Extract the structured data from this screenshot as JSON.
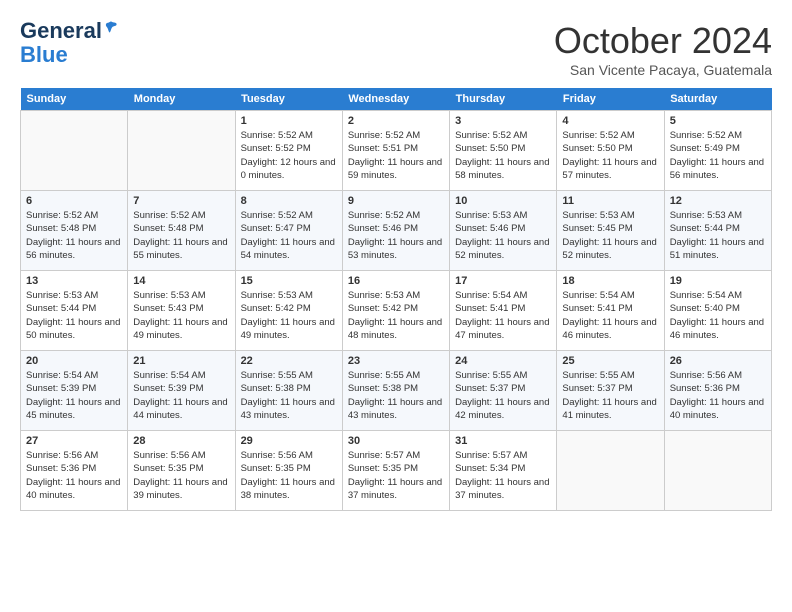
{
  "header": {
    "logo": {
      "line1": "General",
      "line2": "Blue"
    },
    "title": "October 2024",
    "subtitle": "San Vicente Pacaya, Guatemala"
  },
  "weekdays": [
    "Sunday",
    "Monday",
    "Tuesday",
    "Wednesday",
    "Thursday",
    "Friday",
    "Saturday"
  ],
  "weeks": [
    [
      {
        "day": null
      },
      {
        "day": null
      },
      {
        "day": "1",
        "sunrise": "Sunrise: 5:52 AM",
        "sunset": "Sunset: 5:52 PM",
        "daylight": "Daylight: 12 hours and 0 minutes."
      },
      {
        "day": "2",
        "sunrise": "Sunrise: 5:52 AM",
        "sunset": "Sunset: 5:51 PM",
        "daylight": "Daylight: 11 hours and 59 minutes."
      },
      {
        "day": "3",
        "sunrise": "Sunrise: 5:52 AM",
        "sunset": "Sunset: 5:50 PM",
        "daylight": "Daylight: 11 hours and 58 minutes."
      },
      {
        "day": "4",
        "sunrise": "Sunrise: 5:52 AM",
        "sunset": "Sunset: 5:50 PM",
        "daylight": "Daylight: 11 hours and 57 minutes."
      },
      {
        "day": "5",
        "sunrise": "Sunrise: 5:52 AM",
        "sunset": "Sunset: 5:49 PM",
        "daylight": "Daylight: 11 hours and 56 minutes."
      }
    ],
    [
      {
        "day": "6",
        "sunrise": "Sunrise: 5:52 AM",
        "sunset": "Sunset: 5:48 PM",
        "daylight": "Daylight: 11 hours and 56 minutes."
      },
      {
        "day": "7",
        "sunrise": "Sunrise: 5:52 AM",
        "sunset": "Sunset: 5:48 PM",
        "daylight": "Daylight: 11 hours and 55 minutes."
      },
      {
        "day": "8",
        "sunrise": "Sunrise: 5:52 AM",
        "sunset": "Sunset: 5:47 PM",
        "daylight": "Daylight: 11 hours and 54 minutes."
      },
      {
        "day": "9",
        "sunrise": "Sunrise: 5:52 AM",
        "sunset": "Sunset: 5:46 PM",
        "daylight": "Daylight: 11 hours and 53 minutes."
      },
      {
        "day": "10",
        "sunrise": "Sunrise: 5:53 AM",
        "sunset": "Sunset: 5:46 PM",
        "daylight": "Daylight: 11 hours and 52 minutes."
      },
      {
        "day": "11",
        "sunrise": "Sunrise: 5:53 AM",
        "sunset": "Sunset: 5:45 PM",
        "daylight": "Daylight: 11 hours and 52 minutes."
      },
      {
        "day": "12",
        "sunrise": "Sunrise: 5:53 AM",
        "sunset": "Sunset: 5:44 PM",
        "daylight": "Daylight: 11 hours and 51 minutes."
      }
    ],
    [
      {
        "day": "13",
        "sunrise": "Sunrise: 5:53 AM",
        "sunset": "Sunset: 5:44 PM",
        "daylight": "Daylight: 11 hours and 50 minutes."
      },
      {
        "day": "14",
        "sunrise": "Sunrise: 5:53 AM",
        "sunset": "Sunset: 5:43 PM",
        "daylight": "Daylight: 11 hours and 49 minutes."
      },
      {
        "day": "15",
        "sunrise": "Sunrise: 5:53 AM",
        "sunset": "Sunset: 5:42 PM",
        "daylight": "Daylight: 11 hours and 49 minutes."
      },
      {
        "day": "16",
        "sunrise": "Sunrise: 5:53 AM",
        "sunset": "Sunset: 5:42 PM",
        "daylight": "Daylight: 11 hours and 48 minutes."
      },
      {
        "day": "17",
        "sunrise": "Sunrise: 5:54 AM",
        "sunset": "Sunset: 5:41 PM",
        "daylight": "Daylight: 11 hours and 47 minutes."
      },
      {
        "day": "18",
        "sunrise": "Sunrise: 5:54 AM",
        "sunset": "Sunset: 5:41 PM",
        "daylight": "Daylight: 11 hours and 46 minutes."
      },
      {
        "day": "19",
        "sunrise": "Sunrise: 5:54 AM",
        "sunset": "Sunset: 5:40 PM",
        "daylight": "Daylight: 11 hours and 46 minutes."
      }
    ],
    [
      {
        "day": "20",
        "sunrise": "Sunrise: 5:54 AM",
        "sunset": "Sunset: 5:39 PM",
        "daylight": "Daylight: 11 hours and 45 minutes."
      },
      {
        "day": "21",
        "sunrise": "Sunrise: 5:54 AM",
        "sunset": "Sunset: 5:39 PM",
        "daylight": "Daylight: 11 hours and 44 minutes."
      },
      {
        "day": "22",
        "sunrise": "Sunrise: 5:55 AM",
        "sunset": "Sunset: 5:38 PM",
        "daylight": "Daylight: 11 hours and 43 minutes."
      },
      {
        "day": "23",
        "sunrise": "Sunrise: 5:55 AM",
        "sunset": "Sunset: 5:38 PM",
        "daylight": "Daylight: 11 hours and 43 minutes."
      },
      {
        "day": "24",
        "sunrise": "Sunrise: 5:55 AM",
        "sunset": "Sunset: 5:37 PM",
        "daylight": "Daylight: 11 hours and 42 minutes."
      },
      {
        "day": "25",
        "sunrise": "Sunrise: 5:55 AM",
        "sunset": "Sunset: 5:37 PM",
        "daylight": "Daylight: 11 hours and 41 minutes."
      },
      {
        "day": "26",
        "sunrise": "Sunrise: 5:56 AM",
        "sunset": "Sunset: 5:36 PM",
        "daylight": "Daylight: 11 hours and 40 minutes."
      }
    ],
    [
      {
        "day": "27",
        "sunrise": "Sunrise: 5:56 AM",
        "sunset": "Sunset: 5:36 PM",
        "daylight": "Daylight: 11 hours and 40 minutes."
      },
      {
        "day": "28",
        "sunrise": "Sunrise: 5:56 AM",
        "sunset": "Sunset: 5:35 PM",
        "daylight": "Daylight: 11 hours and 39 minutes."
      },
      {
        "day": "29",
        "sunrise": "Sunrise: 5:56 AM",
        "sunset": "Sunset: 5:35 PM",
        "daylight": "Daylight: 11 hours and 38 minutes."
      },
      {
        "day": "30",
        "sunrise": "Sunrise: 5:57 AM",
        "sunset": "Sunset: 5:35 PM",
        "daylight": "Daylight: 11 hours and 37 minutes."
      },
      {
        "day": "31",
        "sunrise": "Sunrise: 5:57 AM",
        "sunset": "Sunset: 5:34 PM",
        "daylight": "Daylight: 11 hours and 37 minutes."
      },
      {
        "day": null
      },
      {
        "day": null
      }
    ]
  ]
}
